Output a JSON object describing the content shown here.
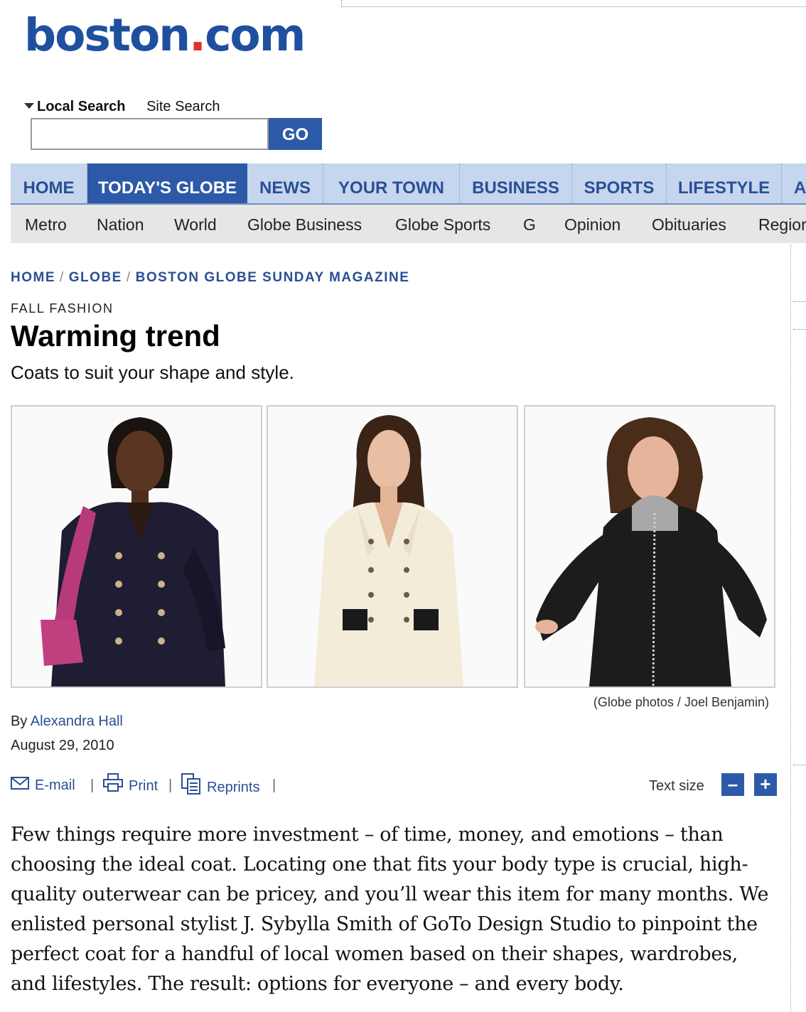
{
  "site": {
    "logo_main": "boston",
    "logo_dot": ".",
    "logo_tld": "com"
  },
  "search": {
    "tabs": [
      "Local Search",
      "Site Search"
    ],
    "input_value": "",
    "go_label": "GO"
  },
  "main_nav": {
    "items": [
      "HOME",
      "TODAY'S GLOBE",
      "NEWS",
      "YOUR TOWN",
      "BUSINESS",
      "SPORTS",
      "LIFESTYLE",
      "A"
    ],
    "active": "TODAY'S GLOBE"
  },
  "sub_nav": {
    "items": [
      "Metro",
      "Nation",
      "World",
      "Globe Business",
      "Globe Sports",
      "G",
      "Opinion",
      "Obituaries",
      "Regior"
    ]
  },
  "breadcrumb": [
    "HOME",
    "GLOBE",
    "BOSTON GLOBE SUNDAY MAGAZINE"
  ],
  "breadcrumb_sep": "/",
  "article": {
    "kicker": "FALL FASHION",
    "headline": "Warming trend",
    "subhead": "Coats to suit your shape and style.",
    "photo_credit": "(Globe photos / Joel Benjamin)",
    "byline_prefix": "By",
    "author": "Alexandra Hall",
    "date": "August 29, 2010",
    "body": "Few things require more investment – of time, money, and emotions – than choosing the ideal coat. Locating one that fits your body type is crucial, high-quality outerwear can be pricey, and you’ll wear this item for many months. We enlisted personal stylist J. Sybylla Smith of GoTo Design Studio to pinpoint the perfect coat for a handful of local women based on their shapes, wardrobes, and lifestyles. The result: options for everyone – and every body."
  },
  "tools": {
    "email": "E-mail",
    "print": "Print",
    "reprints": "Reprints",
    "separator": "|",
    "text_size_label": "Text size",
    "decrease": "–",
    "increase": "+"
  },
  "colors": {
    "brand_blue": "#1f4f9f",
    "logo_dot_red": "#e0312b",
    "nav_bg": "#c5d6ee",
    "nav_active": "#2d5aa8",
    "subnav_bg": "#e6e6e6",
    "link": "#2a4f94"
  }
}
